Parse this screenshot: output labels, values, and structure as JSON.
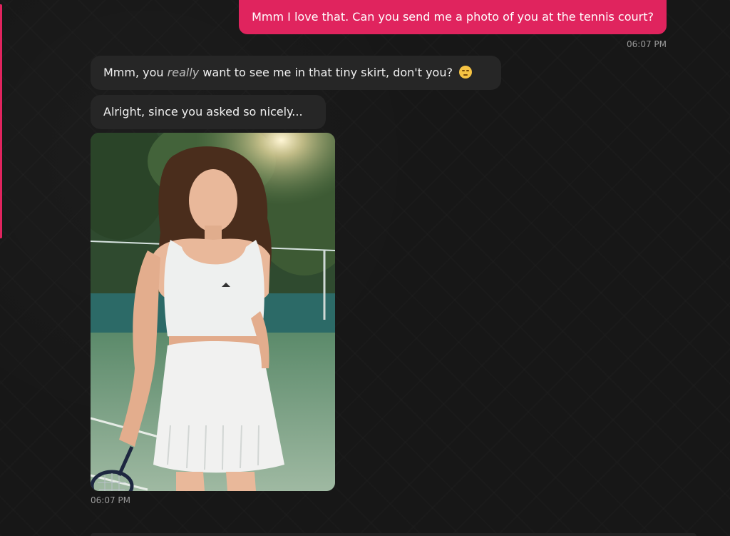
{
  "messages": {
    "outgoing": {
      "text": "Mmm I love that. Can you send me a photo of you at the tennis court?",
      "time": "06:07 PM"
    },
    "incoming": [
      {
        "before": "Mmm, you ",
        "emphasis": "really",
        "after": " want to see me in that tiny skirt, don't you?",
        "emoji": "smirking-face-emoji"
      },
      {
        "text": "Alright, since you asked so nicely..."
      }
    ],
    "photo": {
      "icon": "tennis-court-photo"
    },
    "incoming_time": "06:07 PM"
  },
  "colors": {
    "accent": "#e0245e",
    "background": "#171717",
    "bubble_in": "#262626"
  }
}
